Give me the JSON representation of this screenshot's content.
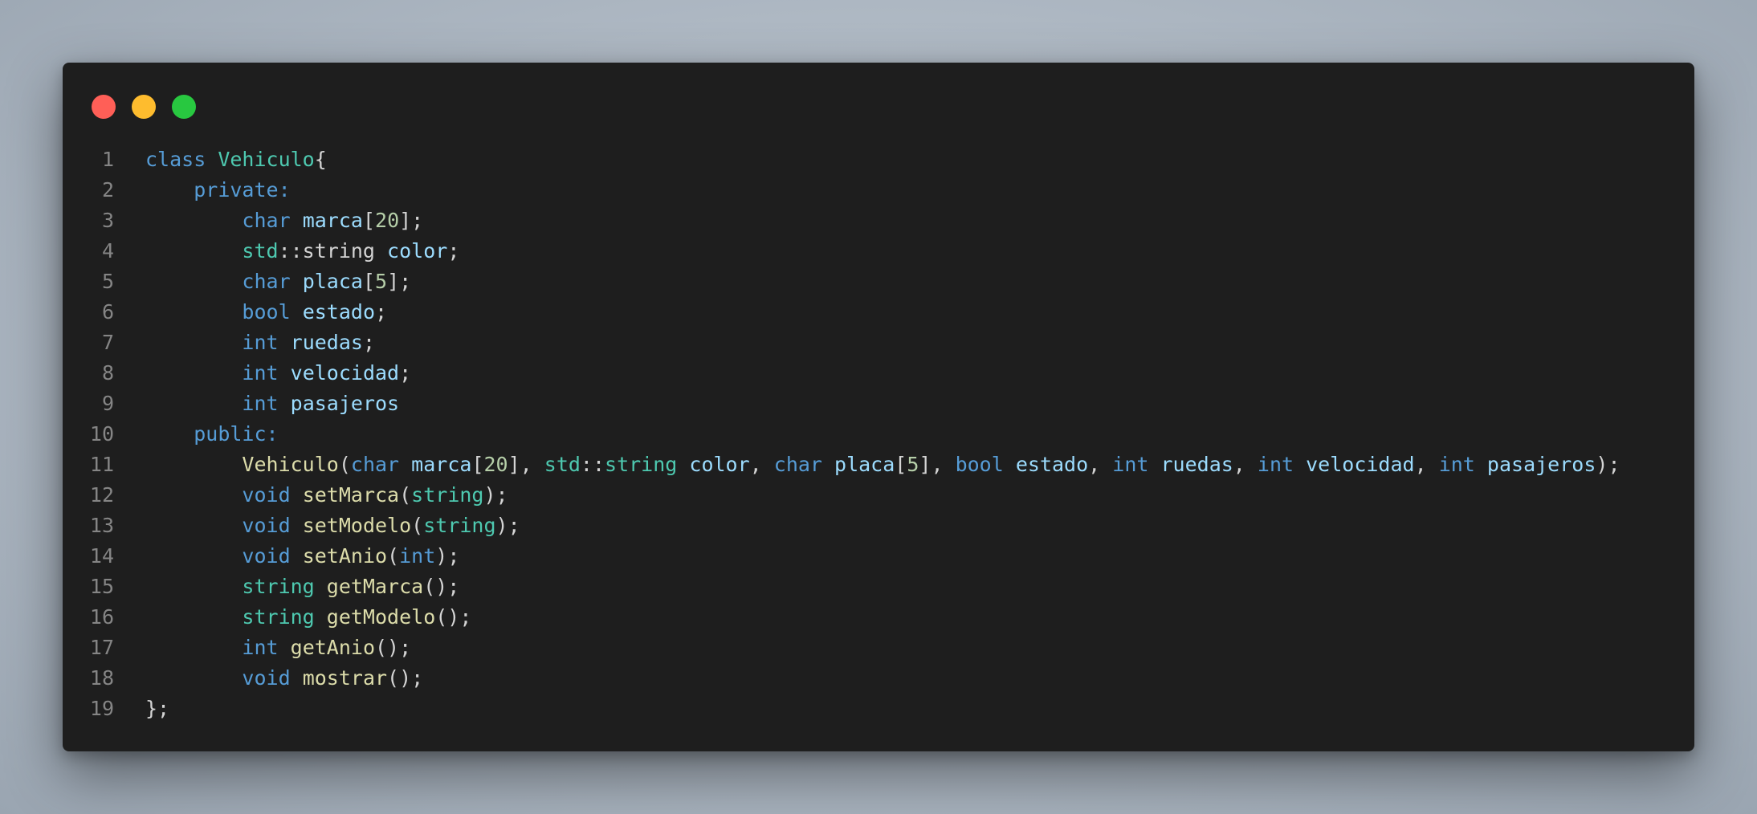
{
  "window": {
    "controls": [
      {
        "name": "close",
        "color": "#ff5f57"
      },
      {
        "name": "minimize",
        "color": "#febc2e"
      },
      {
        "name": "maximize",
        "color": "#28c840"
      }
    ]
  },
  "code": {
    "lines": [
      {
        "number": "1",
        "tokens": [
          [
            "kw",
            "class "
          ],
          [
            "ty",
            "Vehiculo"
          ],
          [
            "pl",
            "{"
          ]
        ]
      },
      {
        "number": "2",
        "tokens": [
          [
            "pl",
            "    "
          ],
          [
            "kw",
            "private:"
          ]
        ]
      },
      {
        "number": "3",
        "tokens": [
          [
            "pl",
            "        "
          ],
          [
            "kw",
            "char "
          ],
          [
            "var",
            "marca"
          ],
          [
            "pl",
            "["
          ],
          [
            "num",
            "20"
          ],
          [
            "pl",
            "];"
          ]
        ]
      },
      {
        "number": "4",
        "tokens": [
          [
            "pl",
            "        "
          ],
          [
            "ty",
            "std"
          ],
          [
            "pl",
            "::string "
          ],
          [
            "var",
            "color"
          ],
          [
            "pl",
            ";"
          ]
        ]
      },
      {
        "number": "5",
        "tokens": [
          [
            "pl",
            "        "
          ],
          [
            "kw",
            "char "
          ],
          [
            "var",
            "placa"
          ],
          [
            "pl",
            "["
          ],
          [
            "num",
            "5"
          ],
          [
            "pl",
            "];"
          ]
        ]
      },
      {
        "number": "6",
        "tokens": [
          [
            "pl",
            "        "
          ],
          [
            "kw",
            "bool "
          ],
          [
            "var",
            "estado"
          ],
          [
            "pl",
            ";"
          ]
        ]
      },
      {
        "number": "7",
        "tokens": [
          [
            "pl",
            "        "
          ],
          [
            "kw",
            "int "
          ],
          [
            "var",
            "ruedas"
          ],
          [
            "pl",
            ";"
          ]
        ]
      },
      {
        "number": "8",
        "tokens": [
          [
            "pl",
            "        "
          ],
          [
            "kw",
            "int "
          ],
          [
            "var",
            "velocidad"
          ],
          [
            "pl",
            ";"
          ]
        ]
      },
      {
        "number": "9",
        "tokens": [
          [
            "pl",
            "        "
          ],
          [
            "kw",
            "int "
          ],
          [
            "var",
            "pasajeros"
          ]
        ]
      },
      {
        "number": "10",
        "tokens": [
          [
            "pl",
            "    "
          ],
          [
            "kw",
            "public:"
          ]
        ]
      },
      {
        "number": "11",
        "tokens": [
          [
            "pl",
            "        "
          ],
          [
            "fn",
            "Vehiculo"
          ],
          [
            "pl",
            "("
          ],
          [
            "kw",
            "char "
          ],
          [
            "var",
            "marca"
          ],
          [
            "pl",
            "["
          ],
          [
            "num",
            "20"
          ],
          [
            "pl",
            "], "
          ],
          [
            "ty",
            "std"
          ],
          [
            "pl",
            "::"
          ],
          [
            "ty",
            "string "
          ],
          [
            "var",
            "color"
          ],
          [
            "pl",
            ", "
          ],
          [
            "kw",
            "char "
          ],
          [
            "var",
            "placa"
          ],
          [
            "pl",
            "["
          ],
          [
            "num",
            "5"
          ],
          [
            "pl",
            "], "
          ],
          [
            "kw",
            "bool "
          ],
          [
            "var",
            "estado"
          ],
          [
            "pl",
            ", "
          ],
          [
            "kw",
            "int "
          ],
          [
            "var",
            "ruedas"
          ],
          [
            "pl",
            ", "
          ],
          [
            "kw",
            "int "
          ],
          [
            "var",
            "velocidad"
          ],
          [
            "pl",
            ", "
          ],
          [
            "kw",
            "int "
          ],
          [
            "var",
            "pasajeros"
          ],
          [
            "pl",
            ");"
          ]
        ]
      },
      {
        "number": "12",
        "tokens": [
          [
            "pl",
            "        "
          ],
          [
            "kw",
            "void "
          ],
          [
            "fn",
            "setMarca"
          ],
          [
            "pl",
            "("
          ],
          [
            "ty",
            "string"
          ],
          [
            "pl",
            ");"
          ]
        ]
      },
      {
        "number": "13",
        "tokens": [
          [
            "pl",
            "        "
          ],
          [
            "kw",
            "void "
          ],
          [
            "fn",
            "setModelo"
          ],
          [
            "pl",
            "("
          ],
          [
            "ty",
            "string"
          ],
          [
            "pl",
            ");"
          ]
        ]
      },
      {
        "number": "14",
        "tokens": [
          [
            "pl",
            "        "
          ],
          [
            "kw",
            "void "
          ],
          [
            "fn",
            "setAnio"
          ],
          [
            "pl",
            "("
          ],
          [
            "kw",
            "int"
          ],
          [
            "pl",
            ");"
          ]
        ]
      },
      {
        "number": "15",
        "tokens": [
          [
            "pl",
            "        "
          ],
          [
            "ty",
            "string "
          ],
          [
            "fn",
            "getMarca"
          ],
          [
            "pl",
            "();"
          ]
        ]
      },
      {
        "number": "16",
        "tokens": [
          [
            "pl",
            "        "
          ],
          [
            "ty",
            "string "
          ],
          [
            "fn",
            "getModelo"
          ],
          [
            "pl",
            "();"
          ]
        ]
      },
      {
        "number": "17",
        "tokens": [
          [
            "pl",
            "        "
          ],
          [
            "kw",
            "int "
          ],
          [
            "fn",
            "getAnio"
          ],
          [
            "pl",
            "();"
          ]
        ]
      },
      {
        "number": "18",
        "tokens": [
          [
            "pl",
            "        "
          ],
          [
            "kw",
            "void "
          ],
          [
            "fn",
            "mostrar"
          ],
          [
            "pl",
            "();"
          ]
        ]
      },
      {
        "number": "19",
        "tokens": [
          [
            "pl",
            "};"
          ]
        ]
      }
    ]
  },
  "syntax_colors": {
    "keyword": "#569cd6",
    "type": "#4ec9b0",
    "function": "#dcdcaa",
    "variable": "#9cdcfe",
    "number": "#b5cea8",
    "plain": "#d4d4d4",
    "line_number": "#858585",
    "editor_background": "#1e1e1e"
  }
}
